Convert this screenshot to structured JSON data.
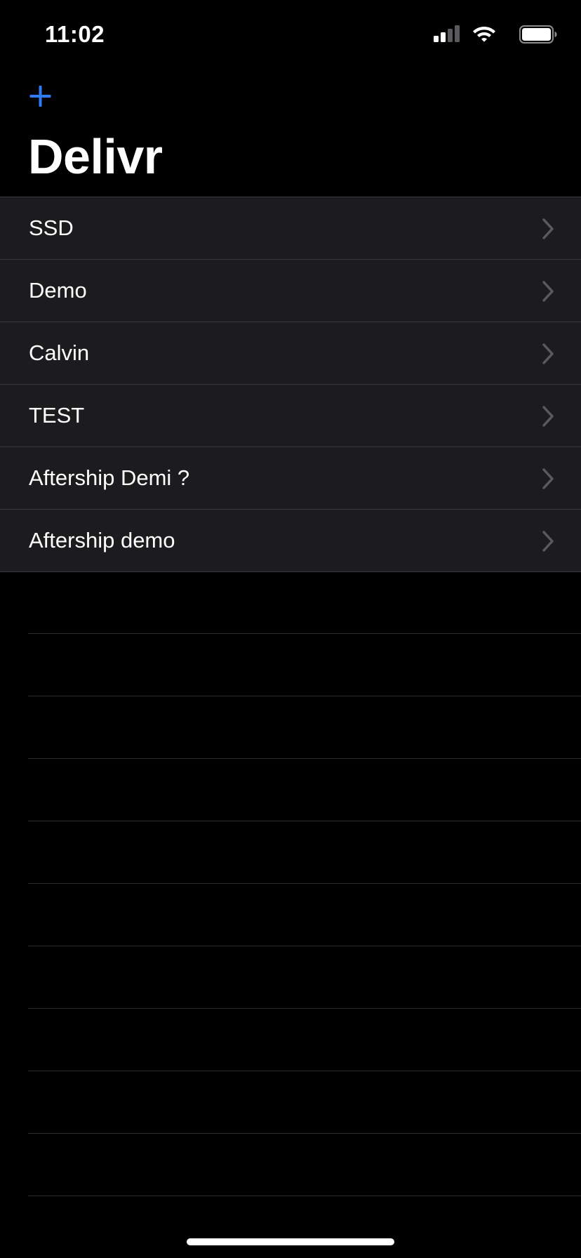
{
  "status_bar": {
    "time": "11:02",
    "icons": [
      "cellular-signal-icon",
      "wifi-icon",
      "battery-icon"
    ]
  },
  "nav": {
    "add_icon": "plus-icon",
    "title": "Delivr"
  },
  "list": {
    "items": [
      {
        "label": "SSD"
      },
      {
        "label": "Demo"
      },
      {
        "label": "Calvin"
      },
      {
        "label": "TEST"
      },
      {
        "label": "Aftership Demi ?"
      },
      {
        "label": "Aftership demo"
      }
    ],
    "chevron_icon": "chevron-right-icon"
  },
  "colors": {
    "background": "#000000",
    "row_background": "#1c1c1e",
    "separator": "#3a3a3c",
    "accent": "#2f7cf6",
    "chevron": "#5a5a5e",
    "text": "#ffffff"
  }
}
